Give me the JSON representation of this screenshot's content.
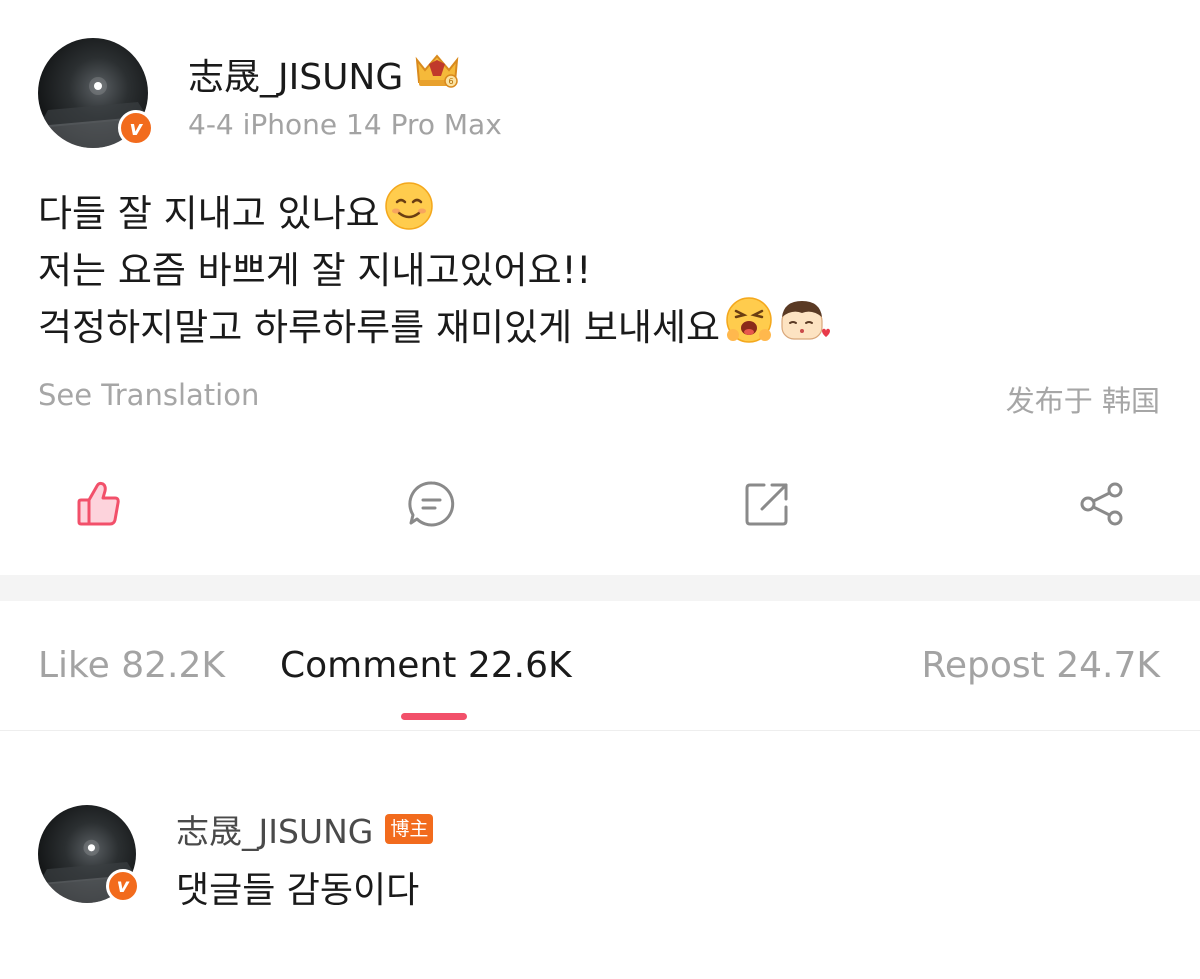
{
  "post": {
    "author": "志晟_JISUNG",
    "meta": "4-4 iPhone 14 Pro Max",
    "lines": [
      "다들 잘 지내고 있나요",
      "저는 요즘 바쁘게 잘 지내고있어요!!",
      "걱정하지말고 하루하루를 재미있게 보내세요"
    ],
    "see_translation": "See Translation",
    "location": "发布于 韩国"
  },
  "actions": {
    "like": "like-icon",
    "comment": "comment-icon",
    "repost": "repost-icon",
    "share": "share-icon"
  },
  "tabs": {
    "like": "Like 82.2K",
    "comment": "Comment 22.6K",
    "repost": "Repost 24.7K"
  },
  "comments": [
    {
      "author": "志晟_JISUNG",
      "tag": "博主",
      "text": "댓글들 감동이다"
    }
  ],
  "colors": {
    "accent": "#f2506a",
    "verified": "#f26b1d",
    "muted_text": "#a3a3a3",
    "separator": "#f4f4f4"
  }
}
